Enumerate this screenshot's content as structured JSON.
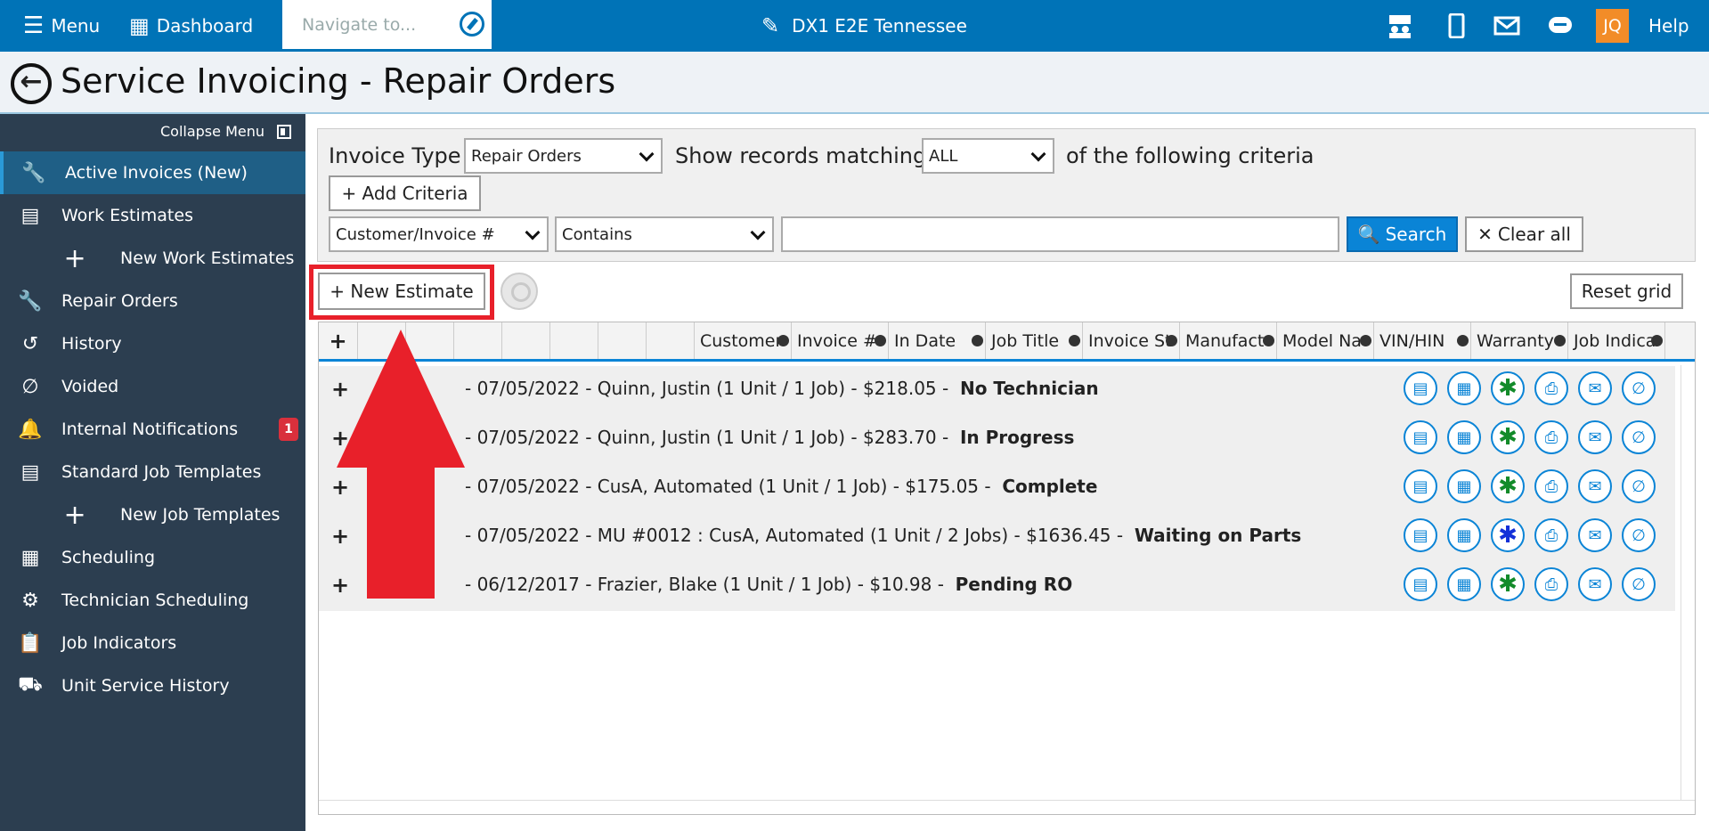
{
  "topbar": {
    "menu": "Menu",
    "dashboard": "Dashboard",
    "navigate_placeholder": "Navigate to...",
    "dealer": "DX1 E2E Tennessee",
    "initials": "JQ",
    "help": "Help"
  },
  "page_title": "Service Invoicing - Repair Orders",
  "sidebar": {
    "collapse": "Collapse Menu",
    "items": [
      {
        "label": "Active Invoices (New)",
        "icon": "wrench-icon"
      },
      {
        "label": "Work Estimates",
        "icon": "document-icon"
      },
      {
        "label": "New Work Estimates",
        "icon": "plus-icon"
      },
      {
        "label": "Repair Orders",
        "icon": "wrench-icon"
      },
      {
        "label": "History",
        "icon": "history-icon"
      },
      {
        "label": "Voided",
        "icon": "void-icon"
      },
      {
        "label": "Internal Notifications",
        "icon": "bell-icon",
        "badge": "1"
      },
      {
        "label": "Standard Job Templates",
        "icon": "document-icon"
      },
      {
        "label": "New Job Templates",
        "icon": "plus-icon"
      },
      {
        "label": "Scheduling",
        "icon": "calendar-icon"
      },
      {
        "label": "Technician Scheduling",
        "icon": "gear-icon"
      },
      {
        "label": "Job Indicators",
        "icon": "clipboard-icon"
      },
      {
        "label": "Unit Service History",
        "icon": "unit-icon"
      }
    ]
  },
  "criteria": {
    "invoice_type_label": "Invoice Type",
    "invoice_type": "Repair Orders",
    "show_label": "Show records matching",
    "match": "ALL",
    "of_label": "of the following criteria",
    "add_criteria": "+ Add Criteria",
    "field": "Customer/Invoice #",
    "operator": "Contains",
    "search": "Search",
    "clear": "Clear all"
  },
  "toolbar": {
    "new_estimate": "+ New Estimate",
    "reset": "Reset grid"
  },
  "grid": {
    "headers": [
      "+",
      "Customer",
      "Invoice #",
      "In Date",
      "Job Title",
      "Invoice St",
      "Manufact",
      "Model Na",
      "VIN/HIN",
      "Warranty",
      "Job Indica"
    ],
    "rows": [
      {
        "text": "- 07/05/2022 - Quinn, Justin (1 Unit / 1 Job) - $218.05 -",
        "status": "No Technician",
        "warranty": "green"
      },
      {
        "text": "- 07/05/2022 - Quinn, Justin (1 Unit / 1 Job) - $283.70 -",
        "status": "In Progress",
        "warranty": "green"
      },
      {
        "text": "- 07/05/2022 - CusA, Automated (1 Unit / 1 Job) - $175.05 -",
        "status": "Complete",
        "warranty": "green"
      },
      {
        "text": "- 07/05/2022 - MU #0012 : CusA, Automated (1 Unit / 2 Jobs) - $1636.45 -",
        "status": "Waiting on Parts",
        "warranty": "blue"
      },
      {
        "text": "- 06/12/2017 - Frazier, Blake (1 Unit / 1 Job) - $10.98 -",
        "status": "Pending RO",
        "warranty": "green"
      }
    ]
  },
  "colors": {
    "brand": "#0073b7",
    "sidebar": "#2c3e50",
    "highlight": "#e8202a"
  }
}
